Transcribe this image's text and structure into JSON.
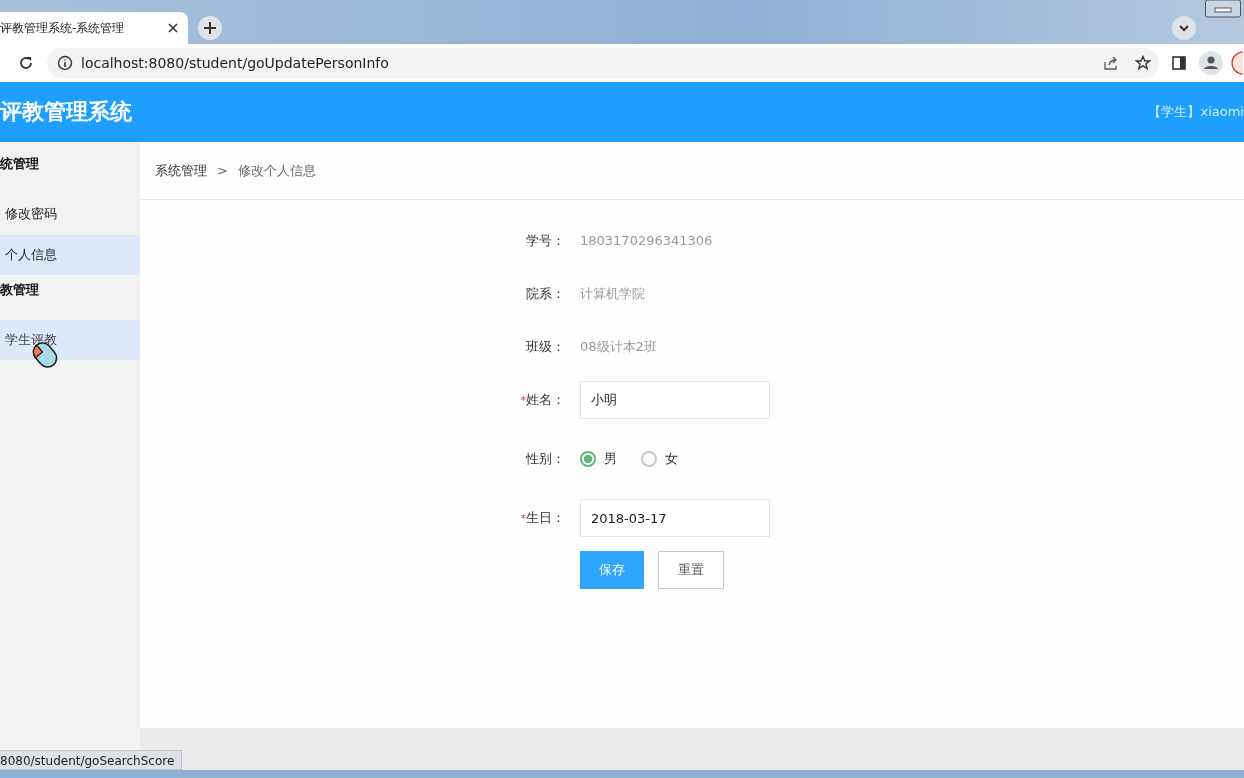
{
  "browser": {
    "tab_title": "评教管理系统-系统管理",
    "url": "localhost:8080/student/goUpdatePersonInfo",
    "status_url": "8080/student/goSearchScore"
  },
  "header": {
    "title": "评教管理系统",
    "user": "【学生】xiaomi"
  },
  "sidebar": {
    "groups": [
      {
        "title": "统管理",
        "items": [
          {
            "label": "修改密码",
            "selected": false,
            "hovered": false
          },
          {
            "label": "个人信息",
            "selected": true,
            "hovered": false
          }
        ]
      },
      {
        "title": "教管理",
        "items": [
          {
            "label": "学生评教",
            "selected": false,
            "hovered": true
          }
        ]
      }
    ]
  },
  "breadcrumb": [
    {
      "label": "系统管理",
      "current": false
    },
    {
      "label": "修改个人信息",
      "current": true
    }
  ],
  "breadcrumb_separator": ">",
  "form": {
    "required_mark": "*",
    "rows": [
      {
        "kind": "text",
        "label": "学号：",
        "required": false,
        "value": "1803170296341306"
      },
      {
        "kind": "text",
        "label": "院系：",
        "required": false,
        "value": "计算机学院"
      },
      {
        "kind": "text",
        "label": "班级：",
        "required": false,
        "value": "08级计本2班"
      },
      {
        "kind": "input",
        "label": "姓名：",
        "required": true,
        "value": "小明"
      },
      {
        "kind": "radio",
        "label": "性别：",
        "required": false,
        "options": [
          {
            "label": "男",
            "selected": true
          },
          {
            "label": "女",
            "selected": false
          }
        ]
      },
      {
        "kind": "input",
        "label": "生日：",
        "required": true,
        "value": "2018-03-17"
      }
    ],
    "buttons": [
      {
        "label": "保存",
        "kind": "primary"
      },
      {
        "label": "重置",
        "kind": "default"
      }
    ]
  }
}
